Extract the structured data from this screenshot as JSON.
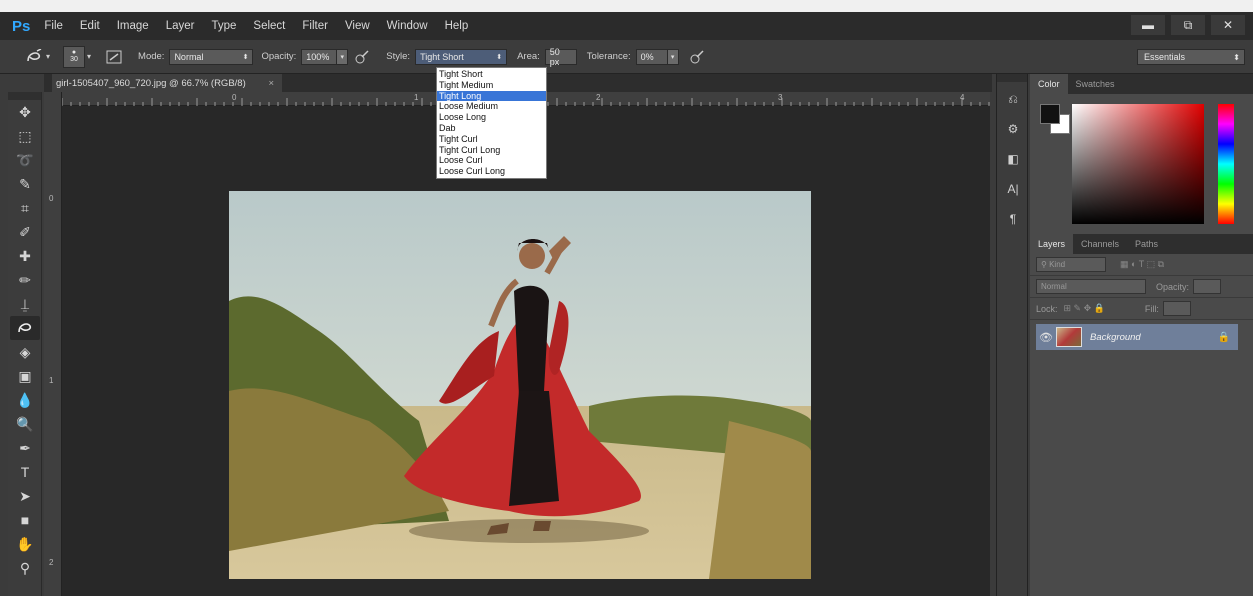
{
  "app": {
    "logo": "Ps"
  },
  "menu": [
    "File",
    "Edit",
    "Image",
    "Layer",
    "Type",
    "Select",
    "Filter",
    "View",
    "Window",
    "Help"
  ],
  "window_controls": {
    "minimize": "▬",
    "restore": "⧉",
    "close": "✕"
  },
  "options": {
    "brush_size": "30",
    "mode_label": "Mode:",
    "mode_value": "Normal",
    "opacity_label": "Opacity:",
    "opacity_value": "100%",
    "style_label": "Style:",
    "style_value": "Tight Short",
    "area_label": "Area:",
    "area_value": "50 px",
    "tolerance_label": "Tolerance:",
    "tolerance_value": "0%",
    "workspace": "Essentials"
  },
  "style_options": [
    "Tight Short",
    "Tight Medium",
    "Tight Long",
    "Loose Medium",
    "Loose Long",
    "Dab",
    "Tight Curl",
    "Tight Curl Long",
    "Loose Curl",
    "Loose Curl Long"
  ],
  "style_highlighted": "Tight Long",
  "document": {
    "tab_title": "girl-1505407_960_720.jpg @ 66.7% (RGB/8)",
    "close": "×"
  },
  "rulers": {
    "top": [
      "0",
      "1",
      "2",
      "3",
      "4"
    ],
    "left": [
      "0",
      "1",
      "2"
    ]
  },
  "panels": {
    "color_tabs": [
      "Color",
      "Swatches"
    ],
    "layer_tabs": [
      "Layers",
      "Channels",
      "Paths"
    ],
    "kind_label": "Kind",
    "blend_mode": "Normal",
    "opacity_label": "Opacity:",
    "lock_label": "Lock:",
    "fill_label": "Fill:",
    "layer_name": "Background"
  },
  "colors": {
    "accent": "#31a8ff",
    "selection": "#3875d7",
    "layer_selected": "#6f7f9a"
  }
}
